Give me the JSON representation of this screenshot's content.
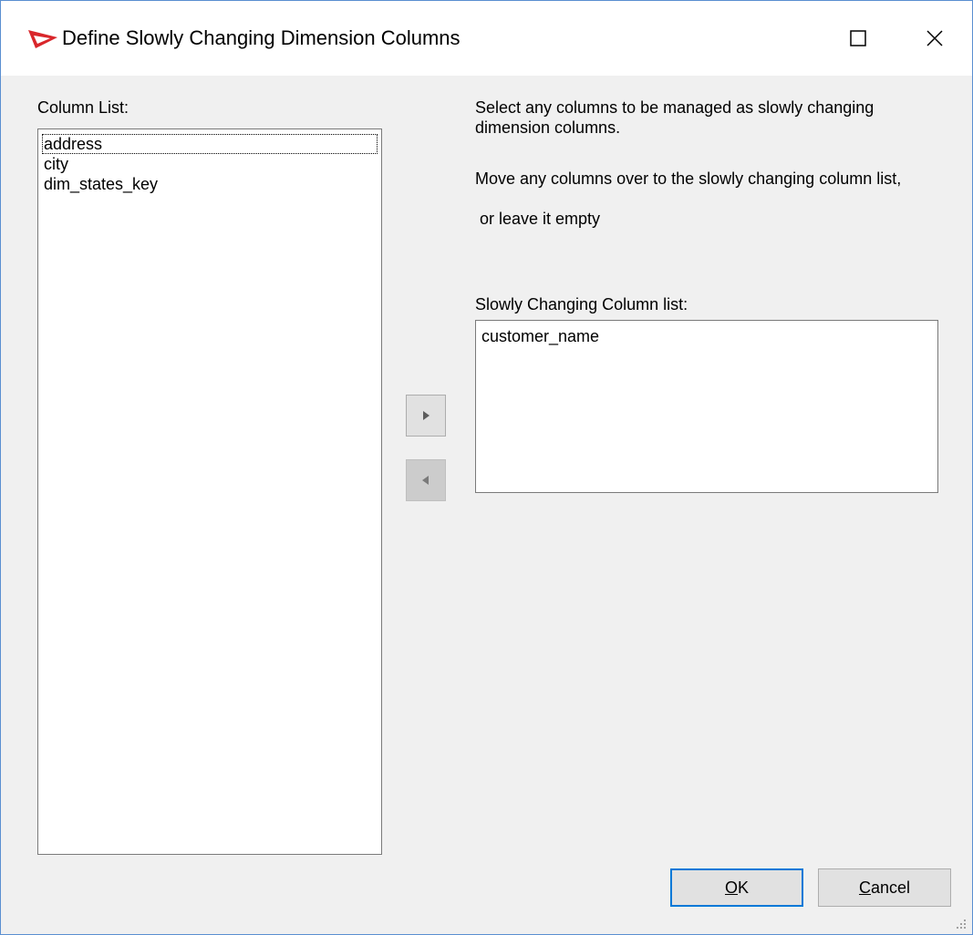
{
  "window": {
    "title": "Define Slowly Changing Dimension Columns",
    "accent_color": "#d9262b"
  },
  "column_list": {
    "label": "Column List:",
    "items": [
      "address",
      "city",
      "dim_states_key"
    ],
    "focused_index": 0
  },
  "instructions": {
    "line1": "Select any columns to be managed as slowly changing dimension columns.",
    "line2": "Move any columns over to the slowly changing column list,",
    "line3": " or leave it empty"
  },
  "scd_list": {
    "label": "Slowly Changing Column list:",
    "items": [
      "customer_name"
    ]
  },
  "buttons": {
    "move_right_icon": "triangle-right-icon",
    "move_left_icon": "triangle-left-icon",
    "ok": {
      "mnemonic": "O",
      "rest": "K"
    },
    "cancel": {
      "mnemonic": "C",
      "rest": "ancel"
    }
  }
}
